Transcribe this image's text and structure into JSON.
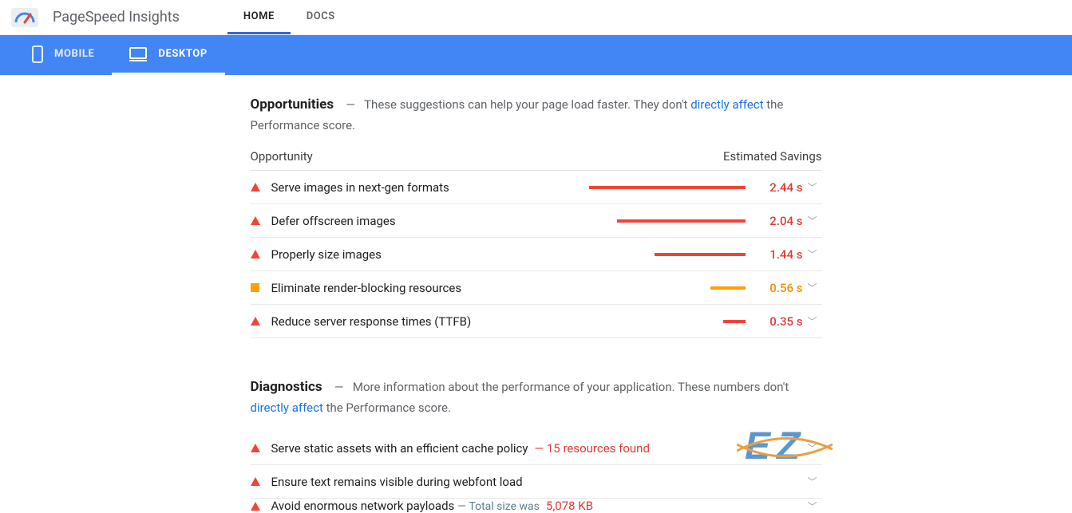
{
  "header": {
    "product": "PageSpeed Insights",
    "nav": {
      "home": "HOME",
      "docs": "DOCS"
    }
  },
  "deviceTabs": {
    "mobile": "MOBILE",
    "desktop": "DESKTOP"
  },
  "opportunities": {
    "title": "Opportunities",
    "desc_before": "These suggestions can help your page load faster. They don't ",
    "desc_link": "directly affect",
    "desc_after": " the Performance score.",
    "col_opportunity": "Opportunity",
    "col_savings": "Estimated Savings",
    "items": [
      {
        "label": "Serve images in next-gen formats",
        "savings": "2.44 s",
        "severity": "red",
        "bar_pct": 100
      },
      {
        "label": "Defer offscreen images",
        "savings": "2.04 s",
        "severity": "red",
        "bar_pct": 82
      },
      {
        "label": "Properly size images",
        "savings": "1.44 s",
        "severity": "red",
        "bar_pct": 58
      },
      {
        "label": "Eliminate render-blocking resources",
        "savings": "0.56 s",
        "severity": "orange",
        "bar_pct": 22
      },
      {
        "label": "Reduce server response times (TTFB)",
        "savings": "0.35 s",
        "severity": "red",
        "bar_pct": 14
      }
    ]
  },
  "diagnostics": {
    "title": "Diagnostics",
    "desc_before": "More information about the performance of your application. These numbers don't ",
    "desc_link": "directly affect",
    "desc_after": " the Performance score.",
    "items": [
      {
        "label": "Serve static assets with an efficient cache policy",
        "extra_red": "— 15 resources found",
        "severity": "red"
      },
      {
        "label": "Ensure text remains visible during webfont load",
        "severity": "red"
      },
      {
        "label": "Avoid enormous network payloads",
        "extra_grey": "— Total size was",
        "extra_red": "5,078 KB",
        "severity": "red"
      }
    ]
  },
  "watermark": "EZ"
}
